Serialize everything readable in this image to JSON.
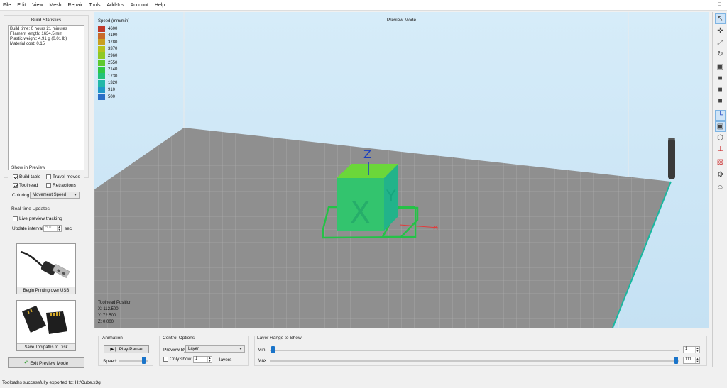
{
  "menu": [
    "File",
    "Edit",
    "View",
    "Mesh",
    "Repair",
    "Tools",
    "Add-Ins",
    "Account",
    "Help"
  ],
  "build_stats": {
    "title": "Build Statistics",
    "lines": [
      "Build time: 0 hours 21 minutes",
      "Filament length: 1634.5 mm",
      "Plastic weight: 4.91 g (0.01 lb)",
      "Material cost: 0.15"
    ]
  },
  "show_in_preview": {
    "title": "Show in Preview",
    "build_table": {
      "label": "Build table",
      "checked": true
    },
    "travel_moves": {
      "label": "Travel moves",
      "checked": false
    },
    "toolhead": {
      "label": "Toolhead",
      "checked": true
    },
    "retractions": {
      "label": "Retractions",
      "checked": false
    },
    "coloring_label": "Coloring",
    "coloring_value": "Movement Speed"
  },
  "realtime": {
    "title": "Real-time Updates",
    "live_label": "Live preview tracking",
    "interval_label": "Update interval",
    "interval_value": "5.0",
    "interval_unit": "sec"
  },
  "usb_button": "Begin Printing over USB",
  "save_button": "Save Toolpaths to Disk",
  "exit_button": "Exit Preview Mode",
  "viewport": {
    "title": "Preview Mode",
    "legend_title": "Speed (mm/min)",
    "legend": [
      {
        "value": "4600",
        "color": "#c0392b"
      },
      {
        "value": "4190",
        "color": "#c86a2a"
      },
      {
        "value": "3780",
        "color": "#c9a021"
      },
      {
        "value": "3370",
        "color": "#b7c21f"
      },
      {
        "value": "2960",
        "color": "#8fc926"
      },
      {
        "value": "2550",
        "color": "#5ec92f"
      },
      {
        "value": "2140",
        "color": "#2fc845"
      },
      {
        "value": "1730",
        "color": "#22c27a"
      },
      {
        "value": "1320",
        "color": "#22b8a8"
      },
      {
        "value": "910",
        "color": "#2098c8"
      },
      {
        "value": "500",
        "color": "#2a6fc7"
      }
    ],
    "toolhead_title": "Toolhead Position",
    "x": "X: 112.500",
    "y": "Y: 72.500",
    "z": "Z: 0.000",
    "axis_z": "Z"
  },
  "animation": {
    "title": "Animation",
    "play": "Play/Pause",
    "speed": "Speed:",
    "speed_level": 0.9
  },
  "control": {
    "title": "Control Options",
    "preview_by": "Preview By",
    "preview_by_value": "Layer",
    "only_show": "Only show",
    "only_show_value": "1",
    "layers": "layers"
  },
  "layer_range": {
    "title": "Layer Range to Show",
    "min_label": "Min",
    "max_label": "Max",
    "min_value": "1",
    "max_value": "111"
  },
  "status": "Toolpaths successfully exported to: H:/Cube.x3g",
  "colors": {
    "sky": "#cfe7f6",
    "bed": "#8f8f8f",
    "accent": "#1a74c9"
  }
}
